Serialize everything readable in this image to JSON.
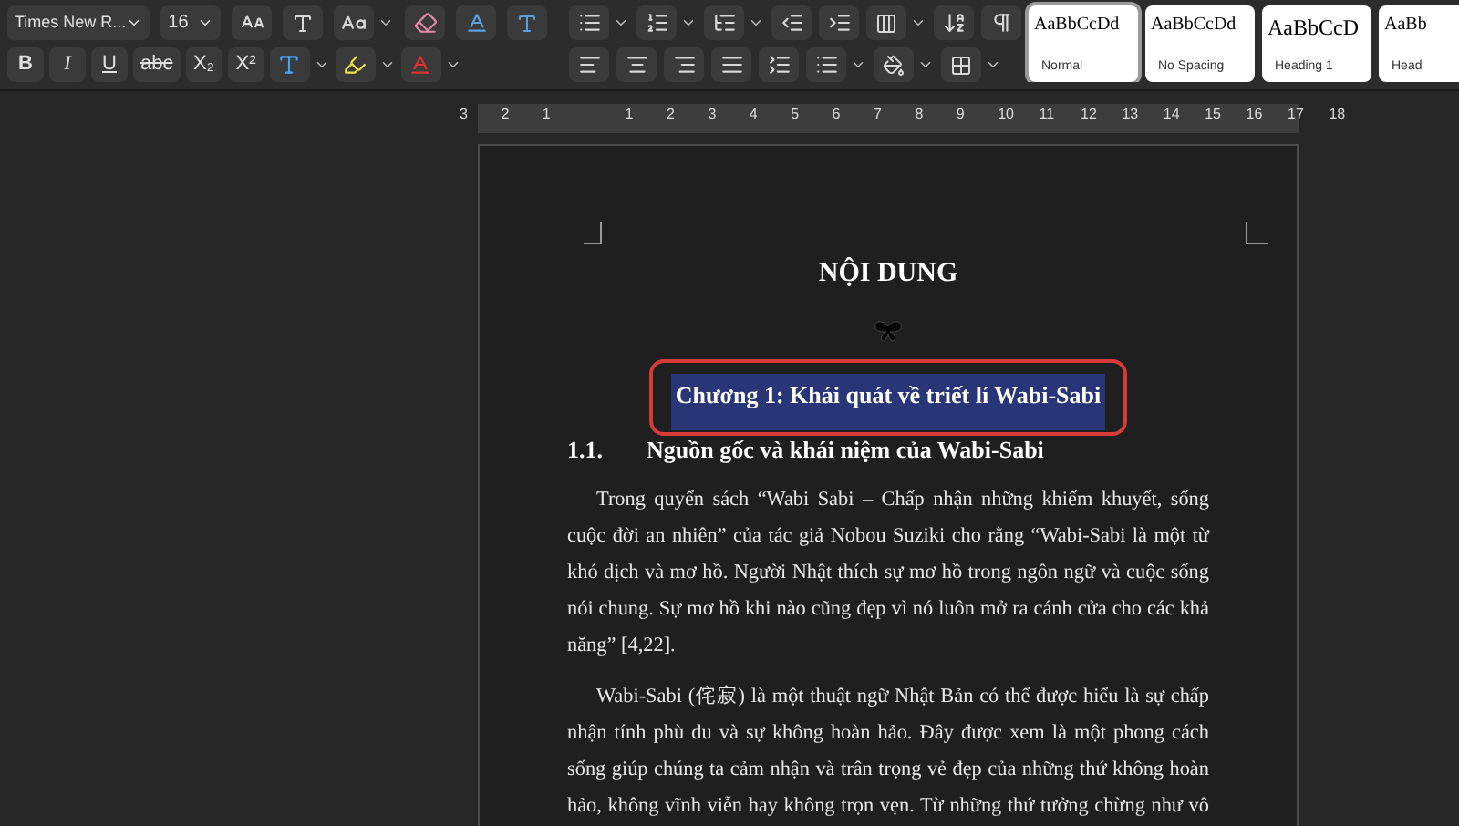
{
  "toolbar": {
    "font_name": "Times New R...",
    "font_size": "16",
    "format_buttons": [
      {
        "label": "B",
        "kind": "bold"
      },
      {
        "label": "I",
        "kind": "italic"
      },
      {
        "label": "U",
        "kind": "underline"
      },
      {
        "label": "abc",
        "kind": "strike"
      },
      {
        "label": "X₂",
        "kind": "sub"
      },
      {
        "label": "X²",
        "kind": "sup"
      }
    ],
    "styles": [
      {
        "sample": "AaBbCcDd",
        "name": "Normal",
        "selected": true
      },
      {
        "sample": "AaBbCcDd",
        "name": "No Spacing",
        "selected": false
      },
      {
        "sample": "AaBbCcD",
        "name": "Heading 1",
        "selected": false
      },
      {
        "sample": "AaBb",
        "name": "Head",
        "selected": false
      }
    ]
  },
  "ruler": {
    "numbers": [
      "3",
      "2",
      "1",
      "1",
      "2",
      "3",
      "4",
      "5",
      "6",
      "7",
      "8",
      "9",
      "10",
      "11",
      "12",
      "13",
      "14",
      "15",
      "16",
      "17",
      "18"
    ]
  },
  "document": {
    "title": "NỘI DUNG",
    "chapter_heading": {
      "text": "Chương 1: Khái quát về triết lí Wabi-Sabi",
      "selected": true,
      "circled": true
    },
    "section": {
      "number": "1.1.",
      "title": "Nguồn gốc và khái niệm của Wabi-Sabi"
    },
    "paragraphs": [
      {
        "lines": [
          "Trong quyển sách “Wabi Sabi – Chấp nhận những khiếm khuyết, sống",
          "cuộc đời an nhiên” của tác giả Nobou Suziki cho rằng “Wabi-Sabi là một từ",
          "khó dịch và mơ hồ. Người Nhật thích sự mơ hồ trong ngôn ngữ và cuộc sống",
          "nói chung. Sự mơ hồ khi nào cũng đẹp vì nó luôn mở ra cánh cửa cho các khả",
          "năng” [4,22]."
        ]
      },
      {
        "lines": [
          "Wabi-Sabi (侘寂) là một thuật ngữ Nhật Bản có thể được hiểu là sự chấp",
          "nhận tính phù du và sự không hoàn hảo. Đây được xem là một phong cách",
          "sống giúp chúng ta cảm nhận và trân trọng vẻ đẹp của những thứ không hoàn",
          "hảo, không vĩnh viễn hay không trọn vẹn. Từ những thứ tưởng chừng như vô"
        ]
      }
    ]
  }
}
